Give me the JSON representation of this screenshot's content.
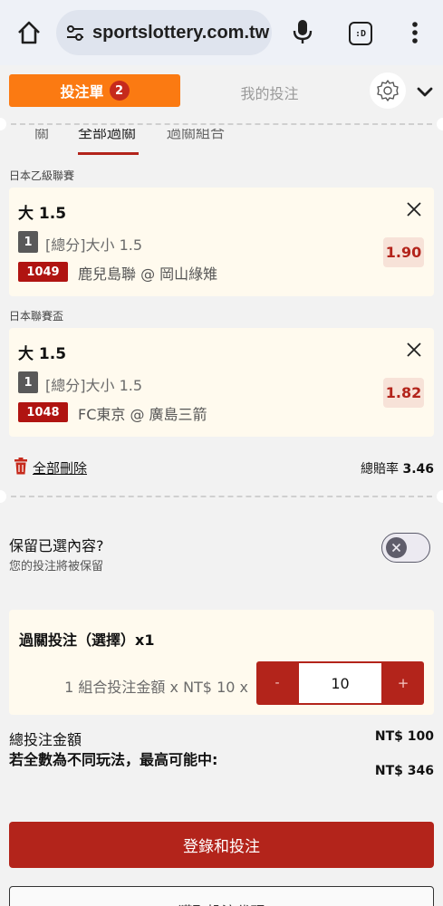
{
  "browser": {
    "url": "sportslottery.com.tw",
    "tabs_icon_label": ":D"
  },
  "header": {
    "betslip_label": "投注單",
    "betslip_count": "2",
    "mybets_label": "我的投注"
  },
  "subtabs": {
    "items": [
      "關",
      "全部過關",
      "過關組合"
    ]
  },
  "bets": [
    {
      "league": "日本乙級聯賽",
      "selection": "大 1.5",
      "leg_number": "1",
      "market": "[總分]大小 1.5",
      "code": "1049",
      "match": "鹿兒島聯 @ 岡山綠雉",
      "odds": "1.90"
    },
    {
      "league": "日本聯賽盃",
      "selection": "大 1.5",
      "leg_number": "1",
      "market": "[總分]大小 1.5",
      "code": "1048",
      "match": "FC東京 @ 廣島三箭",
      "odds": "1.82"
    }
  ],
  "actions": {
    "delete_all": "全部刪除",
    "total_odds_label": "總賠率",
    "total_odds_value": "3.46"
  },
  "keep": {
    "title": "保留已選內容?",
    "subtitle": "您的投注將被保留"
  },
  "parlay": {
    "title": "過關投注（選擇）x1",
    "description": "1 組合投注金額 x NT$ 10 x",
    "minus_label": "-",
    "plus_label": "+",
    "quantity": "10"
  },
  "summary": {
    "total_label": "總投注金額",
    "total_value": "NT$ 100",
    "max_label": "若全數為不同玩法，最高可能中:",
    "max_value": "NT$ 346"
  },
  "buttons": {
    "login_bet": "登錄和投注",
    "get_code": "獲取投注代碼"
  },
  "colors": {
    "brand_orange": "#fb7a12",
    "brand_red": "#b3241b",
    "code_red": "#b01411",
    "card_bg": "#fffaee"
  }
}
